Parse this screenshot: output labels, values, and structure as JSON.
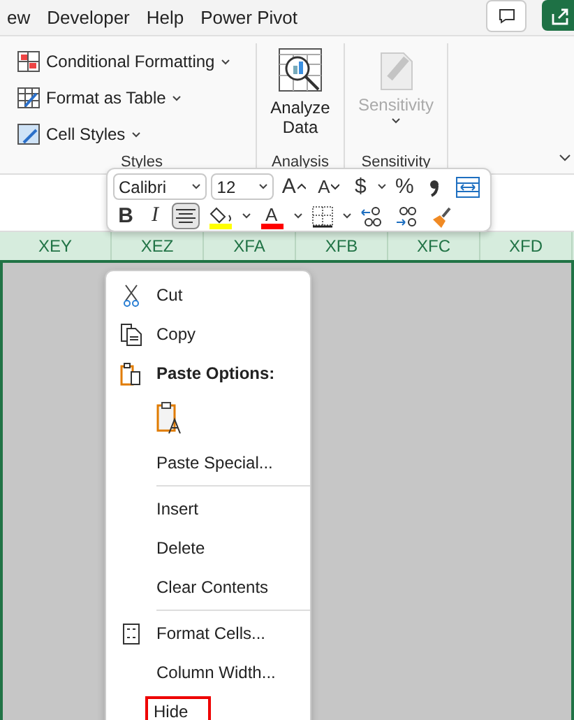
{
  "menu_tabs": [
    "ew",
    "Developer",
    "Help",
    "Power Pivot"
  ],
  "ribbon": {
    "styles": {
      "items": [
        {
          "label": "Conditional Formatting"
        },
        {
          "label": "Format as Table"
        },
        {
          "label": "Cell Styles"
        }
      ],
      "group_label": "Styles"
    },
    "analysis": {
      "button": "Analyze Data",
      "group_label": "Analysis"
    },
    "sensitivity": {
      "button": "Sensitivity",
      "disabled": true,
      "group_label": "Sensitivity"
    }
  },
  "columns": [
    {
      "label": "XEY"
    },
    {
      "label": "XEZ"
    },
    {
      "label": "XFA"
    },
    {
      "label": "XFB"
    },
    {
      "label": "XFC"
    },
    {
      "label": "XFD"
    }
  ],
  "mini_toolbar": {
    "font": "Calibri",
    "size": "12",
    "row1": [
      {
        "kind": "grow",
        "glyph": "A"
      },
      {
        "kind": "shrink",
        "glyph": "A"
      },
      {
        "kind": "text",
        "glyph": "$",
        "caret": true
      },
      {
        "kind": "text",
        "glyph": "%"
      },
      {
        "kind": "comma"
      },
      {
        "kind": "wrap"
      }
    ],
    "row2": [
      {
        "kind": "bold",
        "glyph": "B",
        "selected": false
      },
      {
        "kind": "italic",
        "glyph": "I",
        "selected": false
      },
      {
        "kind": "center",
        "selected": true
      },
      {
        "kind": "fill",
        "color": "#ffff00",
        "caret": true
      },
      {
        "kind": "fontcolor",
        "glyph": "A",
        "color": "#ff0000",
        "caret": true
      },
      {
        "kind": "borders",
        "caret": true
      },
      {
        "kind": "decdec"
      },
      {
        "kind": "incdec"
      },
      {
        "kind": "painter"
      }
    ]
  },
  "context_menu": [
    {
      "kind": "cut",
      "label": "Cut"
    },
    {
      "kind": "copy",
      "label": "Copy"
    },
    {
      "kind": "header",
      "label": "Paste Options:"
    },
    {
      "kind": "paste-option"
    },
    {
      "kind": "item",
      "label": "Paste Special..."
    },
    {
      "kind": "separator"
    },
    {
      "kind": "item",
      "label": "Insert"
    },
    {
      "kind": "item",
      "label": "Delete"
    },
    {
      "kind": "item",
      "label": "Clear Contents"
    },
    {
      "kind": "separator"
    },
    {
      "kind": "format",
      "label": "Format Cells..."
    },
    {
      "kind": "item",
      "label": "Column Width..."
    },
    {
      "kind": "item",
      "label": "Hide",
      "highlighted": true
    }
  ]
}
